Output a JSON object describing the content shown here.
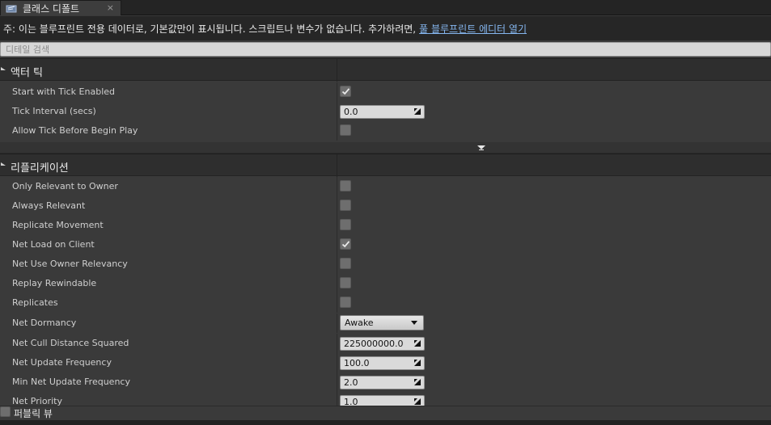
{
  "tab": {
    "title": "클래스 디폴트",
    "close_glyph": "×",
    "icon": "blueprint-class-icon"
  },
  "notice": {
    "text": "주: 이는 블루프린트 전용 데이터로, 기본값만이 표시됩니다. 스크립트나 변수가 없습니다. 추가하려면,",
    "link": "풀 블루프린트 에디터 열기"
  },
  "search": {
    "placeholder": "디테일 검색"
  },
  "actor_tick": {
    "title": "액터 틱",
    "start_with_tick_enabled": {
      "label": "Start with Tick Enabled",
      "checked": true
    },
    "tick_interval": {
      "label": "Tick Interval (secs)",
      "value": "0.0"
    },
    "allow_tick_before_begin_play": {
      "label": "Allow Tick Before Begin Play",
      "checked": false
    }
  },
  "replication": {
    "title": "리플리케이션",
    "only_relevant_to_owner": {
      "label": "Only Relevant to Owner",
      "checked": false
    },
    "always_relevant": {
      "label": "Always Relevant",
      "checked": false
    },
    "replicate_movement": {
      "label": "Replicate Movement",
      "checked": false
    },
    "net_load_on_client": {
      "label": "Net Load on Client",
      "checked": true
    },
    "net_use_owner_relevancy": {
      "label": "Net Use Owner Relevancy",
      "checked": false
    },
    "replay_rewindable": {
      "label": "Replay Rewindable",
      "checked": false
    },
    "replicates": {
      "label": "Replicates",
      "checked": false
    },
    "net_dormancy": {
      "label": "Net Dormancy",
      "value": "Awake"
    },
    "net_cull_distance_squared": {
      "label": "Net Cull Distance Squared",
      "value": "225000000.0"
    },
    "net_update_frequency": {
      "label": "Net Update Frequency",
      "value": "100.0"
    },
    "min_net_update_frequency": {
      "label": "Min Net Update Frequency",
      "value": "2.0"
    },
    "net_priority": {
      "label": "Net Priority",
      "value": "1.0"
    }
  },
  "footer": {
    "public_view_label": "퍼블릭 뷰",
    "public_view_checked": false
  },
  "colors": {
    "link": "#85b6ef",
    "panel_bg": "#3a3a3a",
    "header_bg": "#2e2e2e",
    "notice_bg": "#262626"
  }
}
